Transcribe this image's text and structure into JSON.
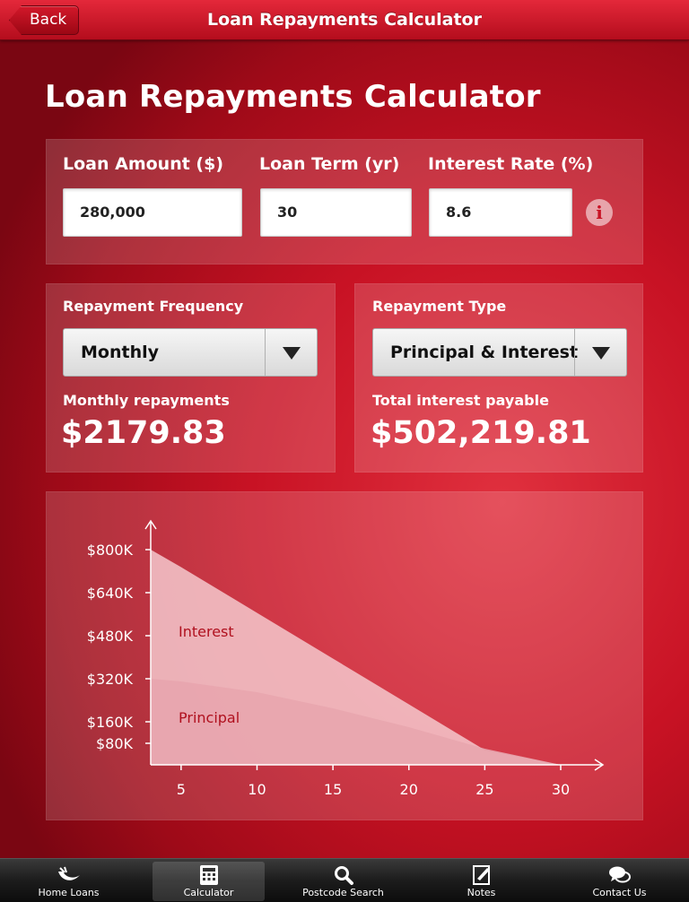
{
  "nav": {
    "back_label": "Back",
    "title": "Loan Repayments Calculator"
  },
  "page_title": "Loan Repayments Calculator",
  "inputs": {
    "loan_amount_label": "Loan Amount ($)",
    "loan_amount_value": "280,000",
    "loan_term_label": "Loan Term (yr)",
    "loan_term_value": "30",
    "interest_rate_label": "Interest Rate (%)",
    "interest_rate_value": "8.6",
    "info_icon": "i"
  },
  "frequency": {
    "label": "Repayment Frequency",
    "selected": "Monthly",
    "result_label": "Monthly repayments",
    "result_value": "$2179.83"
  },
  "type": {
    "label": "Repayment Type",
    "selected": "Principal & Interest",
    "result_label": "Total interest payable",
    "result_value": "$502,219.81"
  },
  "chart_data": {
    "type": "area",
    "x": [
      3,
      5,
      10,
      15,
      20,
      25,
      30
    ],
    "x_ticks": [
      "5",
      "10",
      "15",
      "20",
      "25",
      "30"
    ],
    "y_ticks": [
      "$80K",
      "$160K",
      "$320K",
      "$480K",
      "$640K",
      "$800K"
    ],
    "ylim": [
      0,
      800
    ],
    "series": [
      {
        "name": "Interest",
        "values": [
          800,
          735,
          565,
          395,
          225,
          55,
          0
        ]
      },
      {
        "name": "Principal",
        "values": [
          320,
          310,
          270,
          210,
          140,
          60,
          0
        ]
      }
    ],
    "colors": {
      "interest": "#f4c8cd",
      "principal": "#e8a5ae",
      "text": "#b0101e"
    }
  },
  "tabs": [
    {
      "label": "Home Loans",
      "icon": "home-loans-icon",
      "active": false
    },
    {
      "label": "Calculator",
      "icon": "calculator-icon",
      "active": true
    },
    {
      "label": "Postcode Search",
      "icon": "search-icon",
      "active": false
    },
    {
      "label": "Notes",
      "icon": "notes-icon",
      "active": false
    },
    {
      "label": "Contact Us",
      "icon": "chat-bubbles-icon",
      "active": false
    }
  ]
}
